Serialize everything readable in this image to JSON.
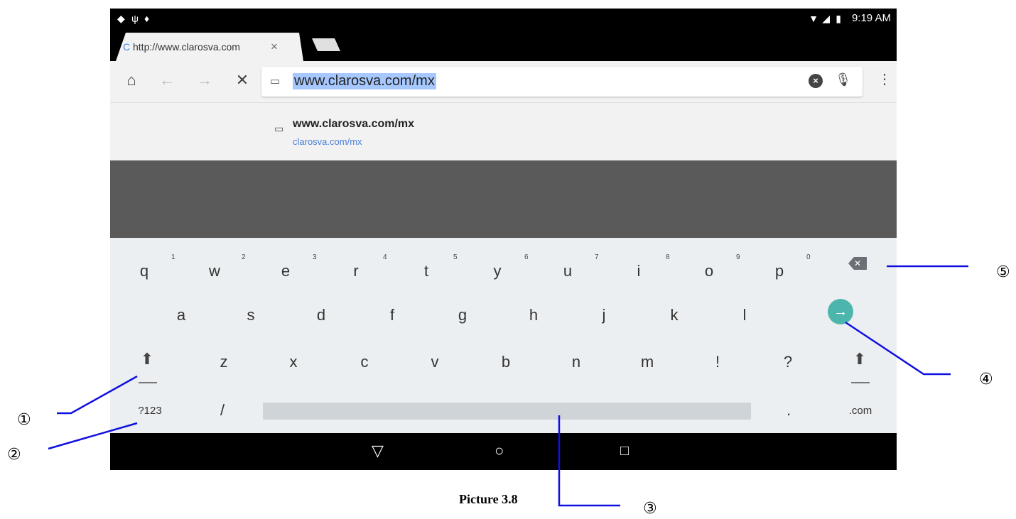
{
  "status_bar": {
    "time": "9:19 AM",
    "left_icons": [
      "app-icon",
      "usb-icon",
      "debug-icon"
    ],
    "right_icons": [
      "wifi-icon",
      "signal-icon",
      "battery-icon"
    ]
  },
  "tab": {
    "title": "http://www.clarosva.com",
    "close_glyph": "×"
  },
  "toolbar": {
    "url": "www.clarosva.com/mx"
  },
  "suggestion": {
    "title": "www.clarosva.com/mx",
    "url": "clarosva.com/mx"
  },
  "keyboard": {
    "row1": [
      {
        "key": "q",
        "hint": "1"
      },
      {
        "key": "w",
        "hint": "2"
      },
      {
        "key": "e",
        "hint": "3"
      },
      {
        "key": "r",
        "hint": "4"
      },
      {
        "key": "t",
        "hint": "5"
      },
      {
        "key": "y",
        "hint": "6"
      },
      {
        "key": "u",
        "hint": "7"
      },
      {
        "key": "i",
        "hint": "8"
      },
      {
        "key": "o",
        "hint": "9"
      },
      {
        "key": "p",
        "hint": "0"
      }
    ],
    "row2": [
      "a",
      "s",
      "d",
      "f",
      "g",
      "h",
      "j",
      "k",
      "l"
    ],
    "row3": [
      "z",
      "x",
      "c",
      "v",
      "b",
      "n",
      "m",
      "!",
      "?"
    ],
    "symbols_label": "?123",
    "slash_label": "/",
    "period_label": ".",
    "dotcom_label": ".com"
  },
  "annotations": {
    "c1": "①",
    "c2": "②",
    "c3": "③",
    "c4": "④",
    "c5": "⑤",
    "caption": "Picture 3.8",
    "line_color": "#1010e0"
  },
  "colors": {
    "enter_key": "#4db6ac",
    "url_highlight": "#a6c8ff",
    "content_bg": "#5a5a5a"
  }
}
